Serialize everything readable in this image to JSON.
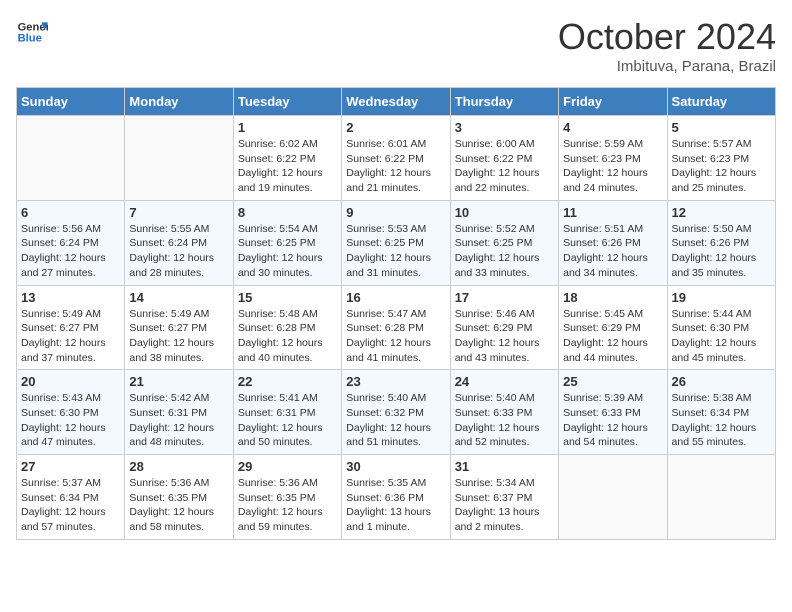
{
  "header": {
    "logo_line1": "General",
    "logo_line2": "Blue",
    "month": "October 2024",
    "location": "Imbituva, Parana, Brazil"
  },
  "days_of_week": [
    "Sunday",
    "Monday",
    "Tuesday",
    "Wednesday",
    "Thursday",
    "Friday",
    "Saturday"
  ],
  "weeks": [
    [
      {
        "day": "",
        "sunrise": "",
        "sunset": "",
        "daylight": ""
      },
      {
        "day": "",
        "sunrise": "",
        "sunset": "",
        "daylight": ""
      },
      {
        "day": "1",
        "sunrise": "Sunrise: 6:02 AM",
        "sunset": "Sunset: 6:22 PM",
        "daylight": "Daylight: 12 hours and 19 minutes."
      },
      {
        "day": "2",
        "sunrise": "Sunrise: 6:01 AM",
        "sunset": "Sunset: 6:22 PM",
        "daylight": "Daylight: 12 hours and 21 minutes."
      },
      {
        "day": "3",
        "sunrise": "Sunrise: 6:00 AM",
        "sunset": "Sunset: 6:22 PM",
        "daylight": "Daylight: 12 hours and 22 minutes."
      },
      {
        "day": "4",
        "sunrise": "Sunrise: 5:59 AM",
        "sunset": "Sunset: 6:23 PM",
        "daylight": "Daylight: 12 hours and 24 minutes."
      },
      {
        "day": "5",
        "sunrise": "Sunrise: 5:57 AM",
        "sunset": "Sunset: 6:23 PM",
        "daylight": "Daylight: 12 hours and 25 minutes."
      }
    ],
    [
      {
        "day": "6",
        "sunrise": "Sunrise: 5:56 AM",
        "sunset": "Sunset: 6:24 PM",
        "daylight": "Daylight: 12 hours and 27 minutes."
      },
      {
        "day": "7",
        "sunrise": "Sunrise: 5:55 AM",
        "sunset": "Sunset: 6:24 PM",
        "daylight": "Daylight: 12 hours and 28 minutes."
      },
      {
        "day": "8",
        "sunrise": "Sunrise: 5:54 AM",
        "sunset": "Sunset: 6:25 PM",
        "daylight": "Daylight: 12 hours and 30 minutes."
      },
      {
        "day": "9",
        "sunrise": "Sunrise: 5:53 AM",
        "sunset": "Sunset: 6:25 PM",
        "daylight": "Daylight: 12 hours and 31 minutes."
      },
      {
        "day": "10",
        "sunrise": "Sunrise: 5:52 AM",
        "sunset": "Sunset: 6:25 PM",
        "daylight": "Daylight: 12 hours and 33 minutes."
      },
      {
        "day": "11",
        "sunrise": "Sunrise: 5:51 AM",
        "sunset": "Sunset: 6:26 PM",
        "daylight": "Daylight: 12 hours and 34 minutes."
      },
      {
        "day": "12",
        "sunrise": "Sunrise: 5:50 AM",
        "sunset": "Sunset: 6:26 PM",
        "daylight": "Daylight: 12 hours and 35 minutes."
      }
    ],
    [
      {
        "day": "13",
        "sunrise": "Sunrise: 5:49 AM",
        "sunset": "Sunset: 6:27 PM",
        "daylight": "Daylight: 12 hours and 37 minutes."
      },
      {
        "day": "14",
        "sunrise": "Sunrise: 5:49 AM",
        "sunset": "Sunset: 6:27 PM",
        "daylight": "Daylight: 12 hours and 38 minutes."
      },
      {
        "day": "15",
        "sunrise": "Sunrise: 5:48 AM",
        "sunset": "Sunset: 6:28 PM",
        "daylight": "Daylight: 12 hours and 40 minutes."
      },
      {
        "day": "16",
        "sunrise": "Sunrise: 5:47 AM",
        "sunset": "Sunset: 6:28 PM",
        "daylight": "Daylight: 12 hours and 41 minutes."
      },
      {
        "day": "17",
        "sunrise": "Sunrise: 5:46 AM",
        "sunset": "Sunset: 6:29 PM",
        "daylight": "Daylight: 12 hours and 43 minutes."
      },
      {
        "day": "18",
        "sunrise": "Sunrise: 5:45 AM",
        "sunset": "Sunset: 6:29 PM",
        "daylight": "Daylight: 12 hours and 44 minutes."
      },
      {
        "day": "19",
        "sunrise": "Sunrise: 5:44 AM",
        "sunset": "Sunset: 6:30 PM",
        "daylight": "Daylight: 12 hours and 45 minutes."
      }
    ],
    [
      {
        "day": "20",
        "sunrise": "Sunrise: 5:43 AM",
        "sunset": "Sunset: 6:30 PM",
        "daylight": "Daylight: 12 hours and 47 minutes."
      },
      {
        "day": "21",
        "sunrise": "Sunrise: 5:42 AM",
        "sunset": "Sunset: 6:31 PM",
        "daylight": "Daylight: 12 hours and 48 minutes."
      },
      {
        "day": "22",
        "sunrise": "Sunrise: 5:41 AM",
        "sunset": "Sunset: 6:31 PM",
        "daylight": "Daylight: 12 hours and 50 minutes."
      },
      {
        "day": "23",
        "sunrise": "Sunrise: 5:40 AM",
        "sunset": "Sunset: 6:32 PM",
        "daylight": "Daylight: 12 hours and 51 minutes."
      },
      {
        "day": "24",
        "sunrise": "Sunrise: 5:40 AM",
        "sunset": "Sunset: 6:33 PM",
        "daylight": "Daylight: 12 hours and 52 minutes."
      },
      {
        "day": "25",
        "sunrise": "Sunrise: 5:39 AM",
        "sunset": "Sunset: 6:33 PM",
        "daylight": "Daylight: 12 hours and 54 minutes."
      },
      {
        "day": "26",
        "sunrise": "Sunrise: 5:38 AM",
        "sunset": "Sunset: 6:34 PM",
        "daylight": "Daylight: 12 hours and 55 minutes."
      }
    ],
    [
      {
        "day": "27",
        "sunrise": "Sunrise: 5:37 AM",
        "sunset": "Sunset: 6:34 PM",
        "daylight": "Daylight: 12 hours and 57 minutes."
      },
      {
        "day": "28",
        "sunrise": "Sunrise: 5:36 AM",
        "sunset": "Sunset: 6:35 PM",
        "daylight": "Daylight: 12 hours and 58 minutes."
      },
      {
        "day": "29",
        "sunrise": "Sunrise: 5:36 AM",
        "sunset": "Sunset: 6:35 PM",
        "daylight": "Daylight: 12 hours and 59 minutes."
      },
      {
        "day": "30",
        "sunrise": "Sunrise: 5:35 AM",
        "sunset": "Sunset: 6:36 PM",
        "daylight": "Daylight: 13 hours and 1 minute."
      },
      {
        "day": "31",
        "sunrise": "Sunrise: 5:34 AM",
        "sunset": "Sunset: 6:37 PM",
        "daylight": "Daylight: 13 hours and 2 minutes."
      },
      {
        "day": "",
        "sunrise": "",
        "sunset": "",
        "daylight": ""
      },
      {
        "day": "",
        "sunrise": "",
        "sunset": "",
        "daylight": ""
      }
    ]
  ]
}
